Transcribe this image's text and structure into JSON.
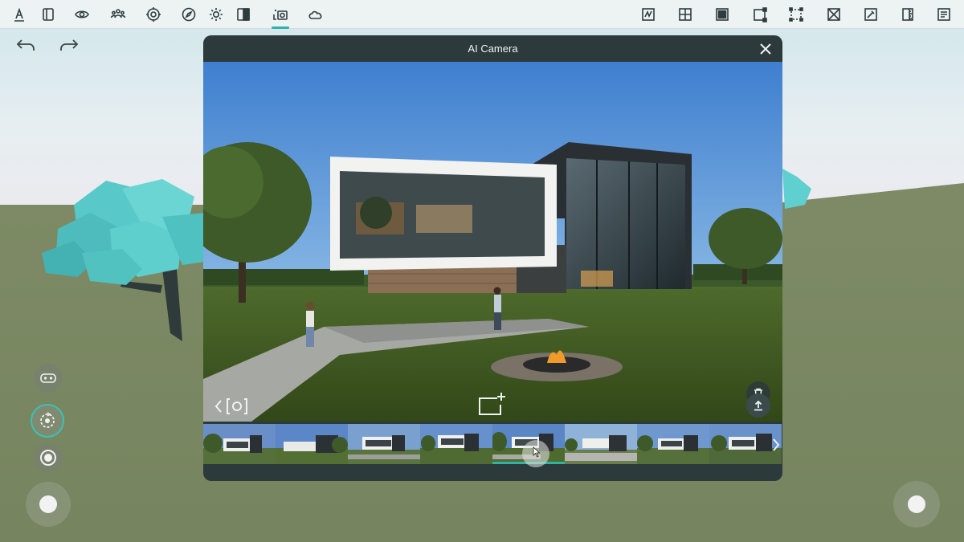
{
  "toolbar": {
    "left_icons": [
      "text-style-icon",
      "panel-icon",
      "eye-icon",
      "people-icon",
      "settings-gear-icon",
      "compass-icon",
      "sun-icon",
      "split-view-icon",
      "ai-camera-icon",
      "cloud-icon"
    ],
    "right_icons": [
      "sketch-icon",
      "grid-icon",
      "solid-square-icon",
      "corner-resize-icon",
      "dashed-select-icon",
      "cross-box-icon",
      "pin-edit-icon",
      "measure-icon",
      "document-icon"
    ],
    "active": "ai-camera-icon",
    "accent_color": "#2fb3a6"
  },
  "history": {
    "undo_icon": "undo-arrow-icon",
    "redo_icon": "redo-arrow-icon"
  },
  "ai_camera": {
    "title": "AI Camera",
    "close_icon": "close-icon",
    "delete_icon": "trash-icon",
    "back_icon": "chevron-left-icon",
    "camera_icon": "camera-frame-icon",
    "add_icon": "add-frame-icon",
    "upload_icon": "upload-icon",
    "thumbnails_count_visible": 8,
    "selected_thumbnail": 5,
    "next_icon": "chevron-right-icon"
  },
  "side_controls": {
    "vr_icon": "vr-headset-icon",
    "rotate_icon": "rotate-camera-icon",
    "record_icon": "record-icon"
  }
}
